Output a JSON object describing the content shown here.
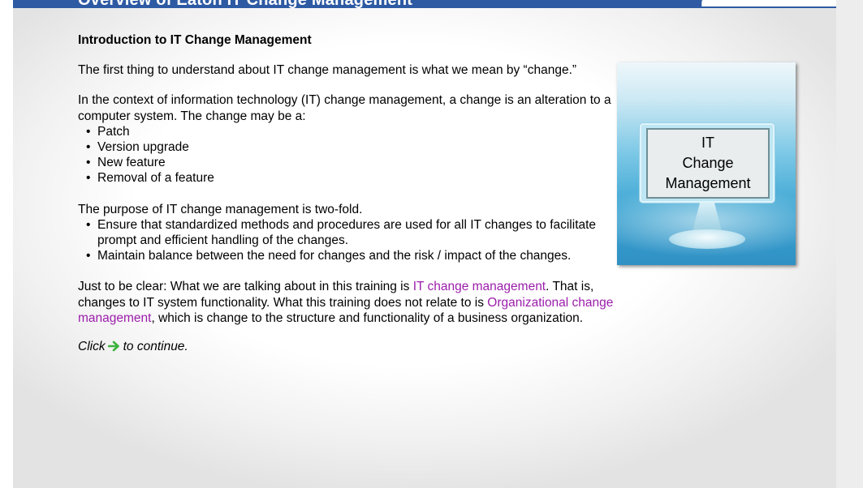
{
  "header": {
    "title": "Overview of Eaton IT Change Management"
  },
  "content": {
    "heading": "Introduction to IT Change Management",
    "intro": "The first thing to understand about IT change management is what we mean by “change.”",
    "context": "In the context of information technology (IT) change management, a change is an alteration to a computer system. The change may be a:",
    "change_types": [
      "Patch",
      "Version upgrade",
      "New feature",
      "Removal of a feature"
    ],
    "purpose": "The purpose of IT change management is two-fold.",
    "purpose_items": [
      "Ensure that standardized methods and procedures are used for all IT changes to facilitate prompt and efficient handling of the changes.",
      "Maintain balance between the need for changes and the risk / impact of the changes."
    ],
    "clarify_prefix": "Just to be clear: What we are talking about in this training is ",
    "clarify_link1": "IT change management",
    "clarify_middle": ". That is, changes to IT system functionality. What this training does not relate to is ",
    "clarify_link2": "Organizational change management",
    "clarify_suffix": ", which is change to the structure and functionality of a business organization.",
    "click_prefix": "Click",
    "click_suffix": "to continue.",
    "continue_icon": "right-arrow-icon"
  },
  "image": {
    "screen_lines": [
      "IT",
      "Change",
      "Management"
    ]
  },
  "colors": {
    "title_bar": "#2e5aa3",
    "link": "#9b1dab",
    "arrow": "#3bb33b"
  }
}
